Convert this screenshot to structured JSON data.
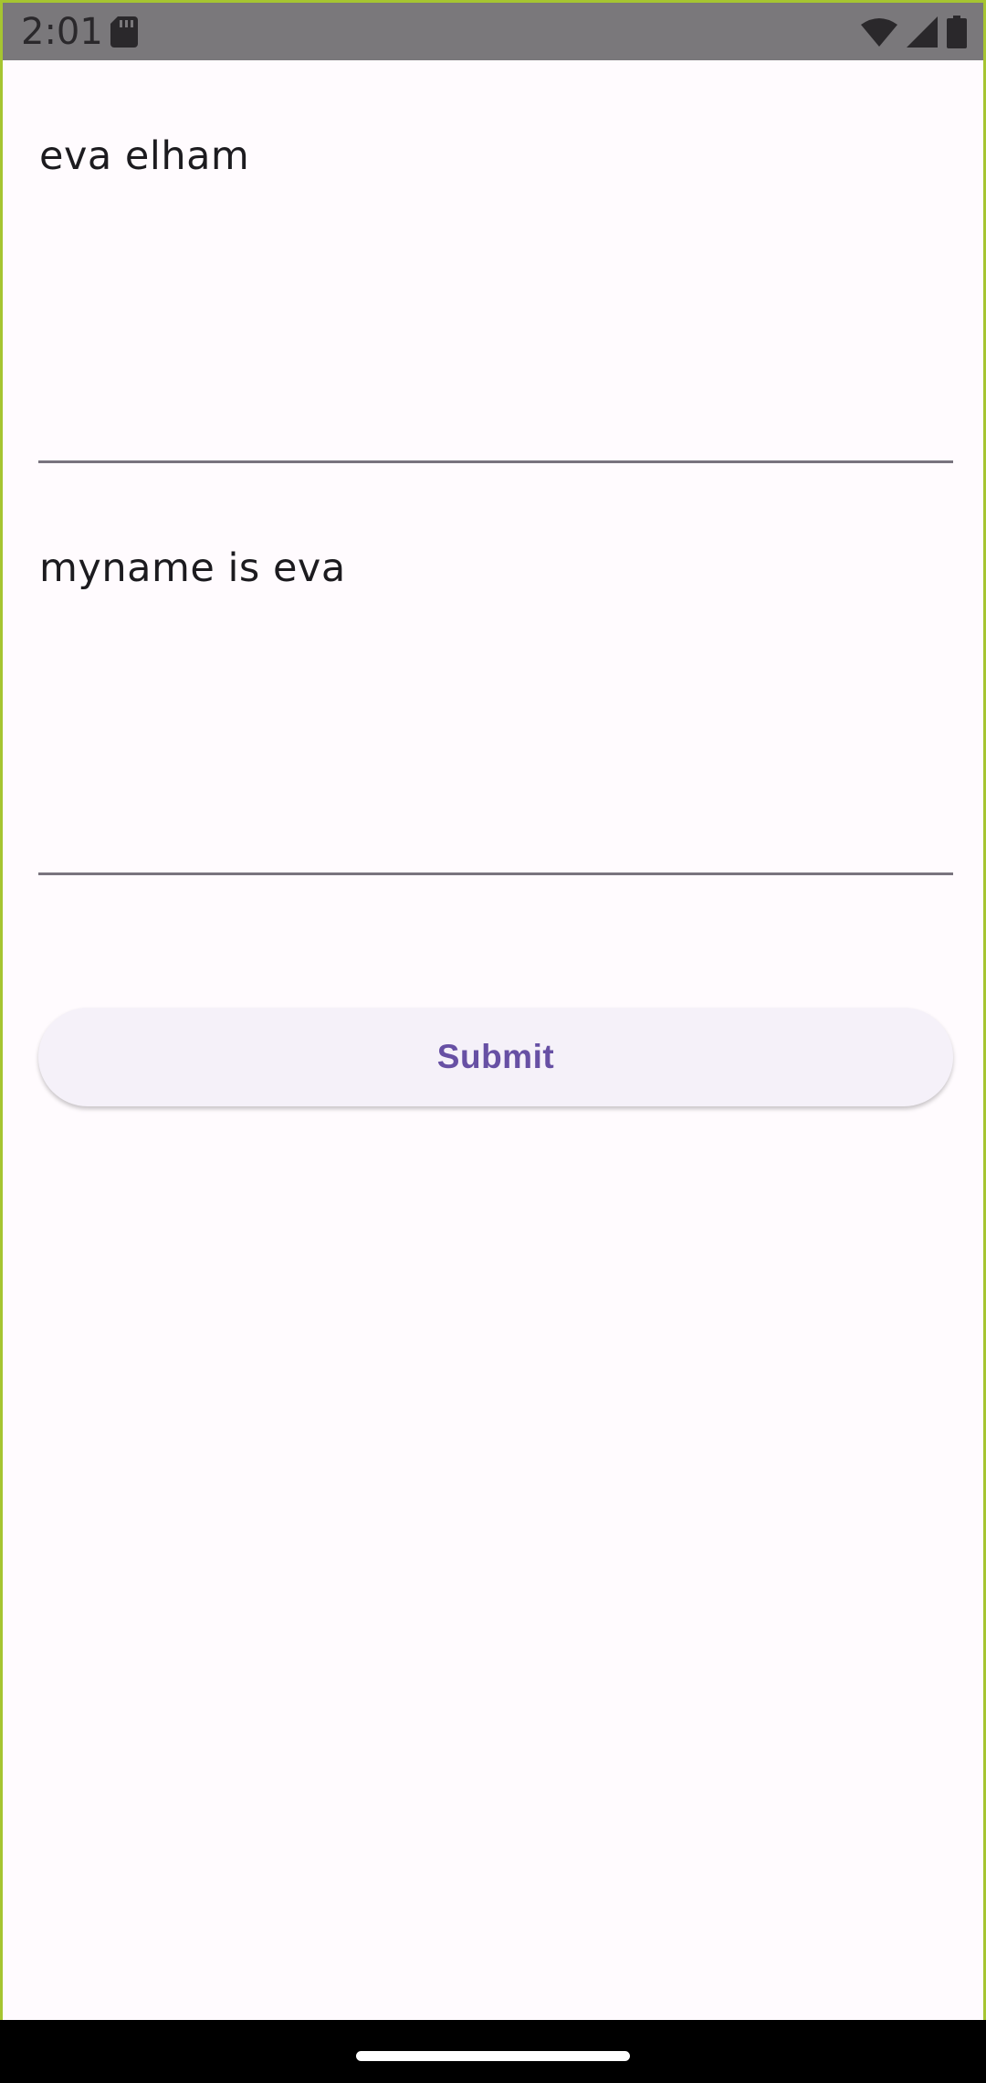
{
  "status_bar": {
    "time": "2:01",
    "icons": [
      "sd-card-icon",
      "wifi-icon",
      "signal-icon",
      "battery-icon"
    ]
  },
  "form": {
    "name_field": {
      "value": "eva elham"
    },
    "message_field": {
      "value": "myname is eva"
    },
    "submit_label": "Submit"
  },
  "colors": {
    "accent": "#6750a4",
    "background": "#fffbfe",
    "button_background": "#f5f1f9",
    "underline": "#79747e",
    "frame_border": "#a6c531"
  }
}
